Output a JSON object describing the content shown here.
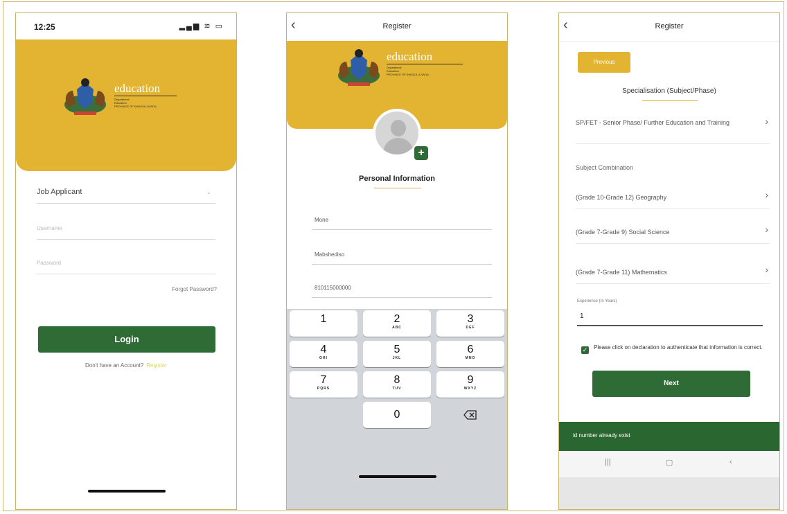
{
  "colors": {
    "accent_gold": "#e3b431",
    "brand_green": "#2f6b35",
    "toast_green": "#2a6630"
  },
  "logo": {
    "icon": "coat-of-arms-icon",
    "word": "education",
    "lines": [
      "Department:",
      "Education",
      "PROVINCE OF KWAZULU-NATAL"
    ]
  },
  "screen1": {
    "time": "12:25",
    "status_icons": "signal-wifi-battery-icons",
    "role_value": "Job Applicant",
    "username_placeholder": "Username",
    "password_placeholder": "Password",
    "forgot_label": "Forgot Password?",
    "login_label": "Login",
    "no_account_text": "Don't have an Account?",
    "register_link": "Register"
  },
  "screen2": {
    "title": "Register",
    "section_title": "Personal Information",
    "first_name": "Mone",
    "last_name": "Mabshediso",
    "id_number": "810115000000",
    "keys": [
      {
        "d": "1",
        "l": ""
      },
      {
        "d": "2",
        "l": "ABC"
      },
      {
        "d": "3",
        "l": "DEF"
      },
      {
        "d": "4",
        "l": "GHI"
      },
      {
        "d": "5",
        "l": "JKL"
      },
      {
        "d": "6",
        "l": "MNO"
      },
      {
        "d": "7",
        "l": "PQRS"
      },
      {
        "d": "8",
        "l": "TUV"
      },
      {
        "d": "9",
        "l": "WXYZ"
      },
      {
        "d": "0",
        "l": ""
      }
    ]
  },
  "screen3": {
    "title": "Register",
    "previous_label": "Previous",
    "spec_title": "Specialisation (Subject/Phase)",
    "phase_text": "SP/FET - Senior Phase/ Further Education and Training",
    "subject_heading": "Subject Combination",
    "subjects": [
      "(Grade 10-Grade 12) Geography",
      "(Grade 7-Grade 9) Social Science",
      "(Grade 7-Grade 11) Mathematics"
    ],
    "experience_label": "Experience (In Years)",
    "experience_value": "1",
    "declaration": "Please click on declaration to authenticate that information is correct.",
    "next_label": "Next",
    "toast": "id number already exist"
  }
}
